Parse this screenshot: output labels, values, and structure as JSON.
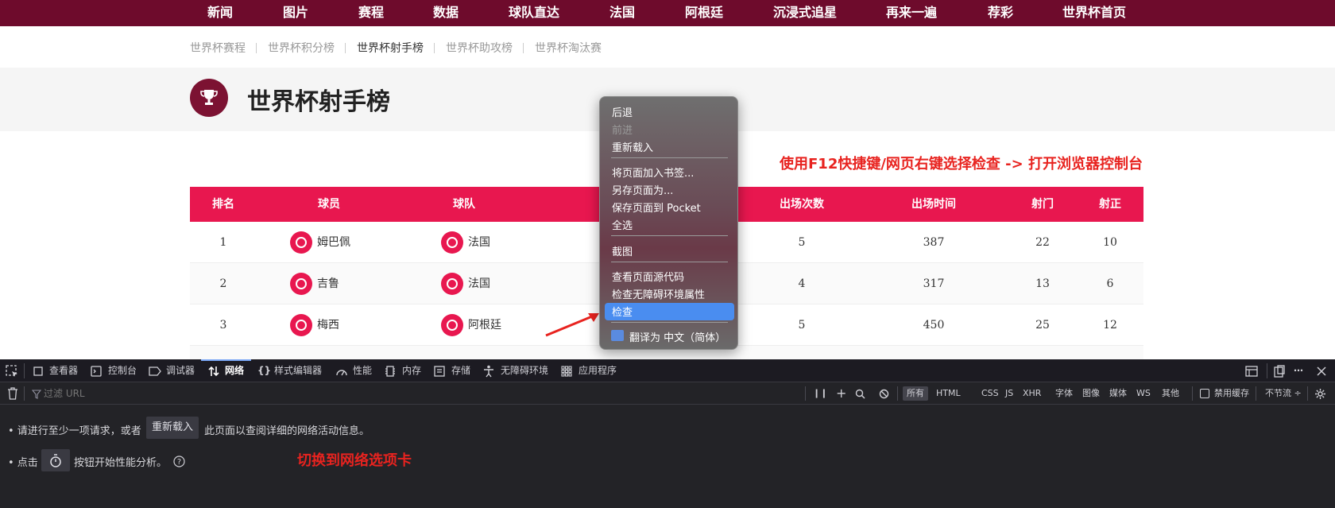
{
  "topnav": {
    "items": [
      "新闻",
      "图片",
      "赛程",
      "数据",
      "球队直达",
      "法国",
      "阿根廷",
      "沉浸式追星",
      "再来一遍",
      "荐彩",
      "世界杯首页"
    ]
  },
  "subnav": {
    "items": [
      "世界杯赛程",
      "世界杯积分榜",
      "世界杯射手榜",
      "世界杯助攻榜",
      "世界杯淘汰赛"
    ],
    "active": "世界杯射手榜"
  },
  "page": {
    "title": "世界杯射手榜"
  },
  "annotations": {
    "top": "使用F12快捷键/网页右键选择检查 -> 打开浏览器控制台",
    "bottom": "切换到网络选项卡"
  },
  "table": {
    "headers": {
      "rank": "排名",
      "player": "球员",
      "team": "球队",
      "appearances": "出场次数",
      "minutes": "出场时间",
      "shots": "射门",
      "on_target": "射正"
    },
    "rows": [
      {
        "rank": "1",
        "player": "姆巴佩",
        "team": "法国",
        "appearances": "5",
        "minutes": "387",
        "shots": "22",
        "on_target": "10"
      },
      {
        "rank": "2",
        "player": "吉鲁",
        "team": "法国",
        "appearances": "4",
        "minutes": "317",
        "shots": "13",
        "on_target": "6"
      },
      {
        "rank": "3",
        "player": "梅西",
        "team": "阿根廷",
        "appearances": "5",
        "minutes": "450",
        "shots": "25",
        "on_target": "12"
      }
    ]
  },
  "context_menu": {
    "back": "后退",
    "forward": "前进",
    "reload": "重新载入",
    "bookmark": "将页面加入书签...",
    "save_as": "另存页面为...",
    "pocket": "保存页面到 Pocket",
    "select_all": "全选",
    "screenshot": "截图",
    "view_source": "查看页面源代码",
    "a11y": "检查无障碍环境属性",
    "inspect": "检查",
    "translate": "翻译为 中文（简体）"
  },
  "devtools": {
    "tabs": {
      "inspector": "查看器",
      "console": "控制台",
      "debugger": "调试器",
      "network": "网络",
      "style_editor": "样式编辑器",
      "performance": "性能",
      "memory": "内存",
      "storage": "存储",
      "accessibility": "无障碍环境",
      "application": "应用程序"
    },
    "filter_placeholder": "过滤 URL",
    "types": [
      "所有",
      "HTML",
      "CSS",
      "JS",
      "XHR",
      "字体",
      "图像",
      "媒体",
      "WS",
      "其他"
    ],
    "disable_cache": "禁用缓存",
    "throttle": "不节流 ÷",
    "msg1_pre": "• 请进行至少一项请求，或者",
    "msg1_btn": "重新载入",
    "msg1_post": "此页面以查阅详细的网络活动信息。",
    "msg2_pre": "• 点击",
    "msg2_post": "按钮开始性能分析。"
  },
  "colors": {
    "topnav_bg": "#6e0b2c",
    "table_header": "#e8174f",
    "annotation": "#e8231f",
    "highlight": "#4a8df0"
  }
}
